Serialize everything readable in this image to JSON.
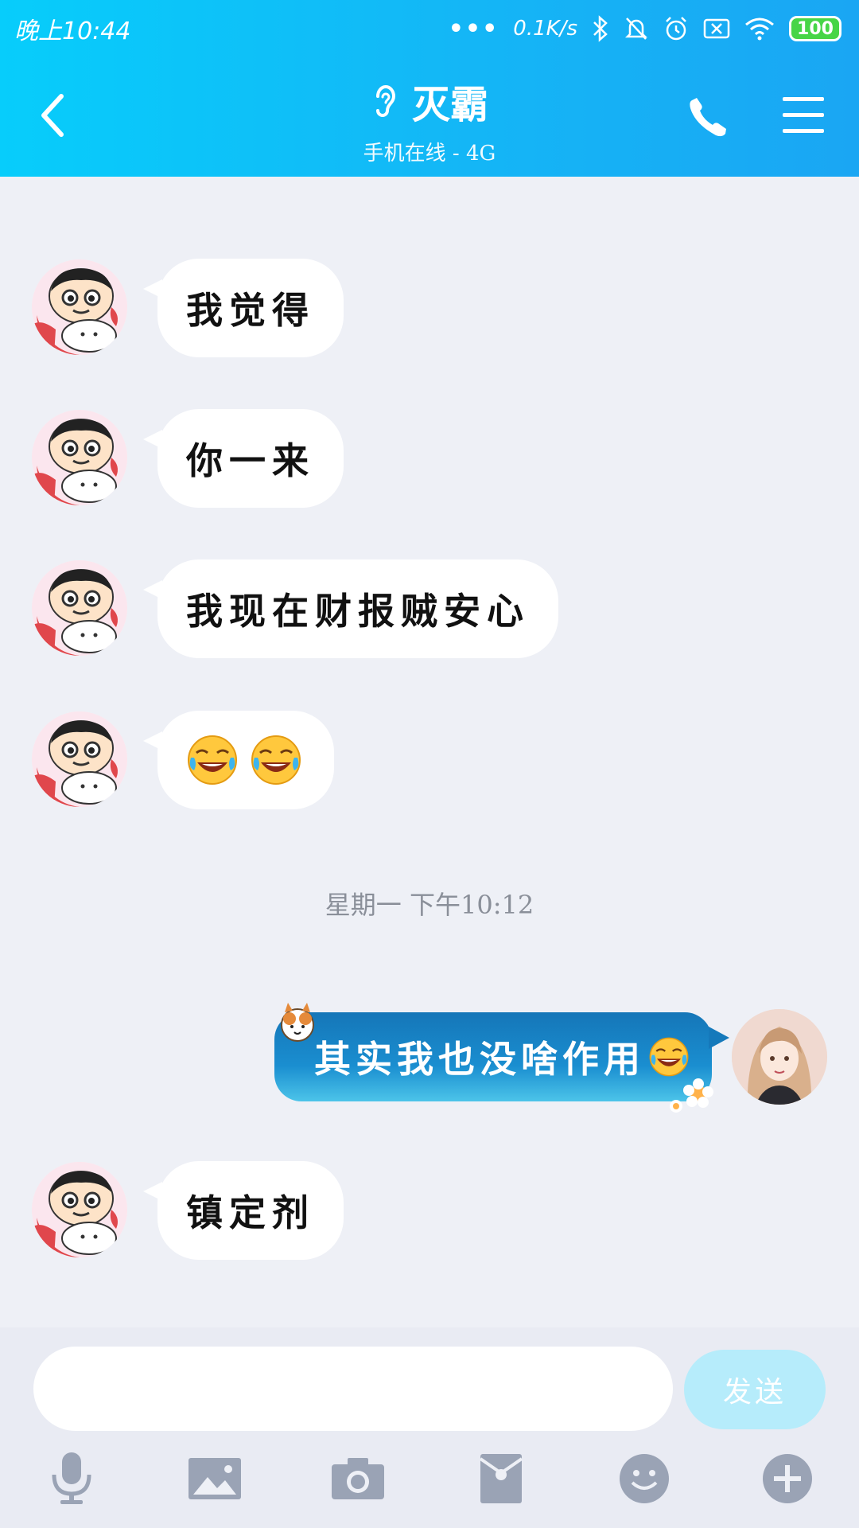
{
  "status_bar": {
    "time": "晚上10:44",
    "dots": "•••",
    "speed": "0.1K/s",
    "battery": "100"
  },
  "header": {
    "title": "灭霸",
    "subtitle": "手机在线 - 4G"
  },
  "messages": [
    {
      "side": "left",
      "text": "我觉得"
    },
    {
      "side": "left",
      "text": "你一来"
    },
    {
      "side": "left",
      "text": "我现在财报贼安心"
    },
    {
      "side": "left",
      "emoji": [
        "laugh-tears",
        "laugh-tears"
      ]
    }
  ],
  "time_divider": "星期一 下午10:12",
  "sent_message": {
    "text": "其实我也没啥作用",
    "emoji": "laugh-tears"
  },
  "last_message": {
    "side": "left",
    "text": "镇定剂"
  },
  "input": {
    "value": "",
    "send_label": "发送"
  },
  "colors": {
    "header_start": "#07cdfb",
    "header_end": "#1aa6f3",
    "bubble_left": "#ffffff",
    "bubble_sent": "#1a8ed0",
    "send_button": "#b6ecfb",
    "battery": "#47d547"
  },
  "icons": [
    "back-icon",
    "ear-icon",
    "phone-icon",
    "menu-icon",
    "microphone-icon",
    "image-icon",
    "camera-icon",
    "red-packet-icon",
    "emoji-icon",
    "plus-icon"
  ]
}
